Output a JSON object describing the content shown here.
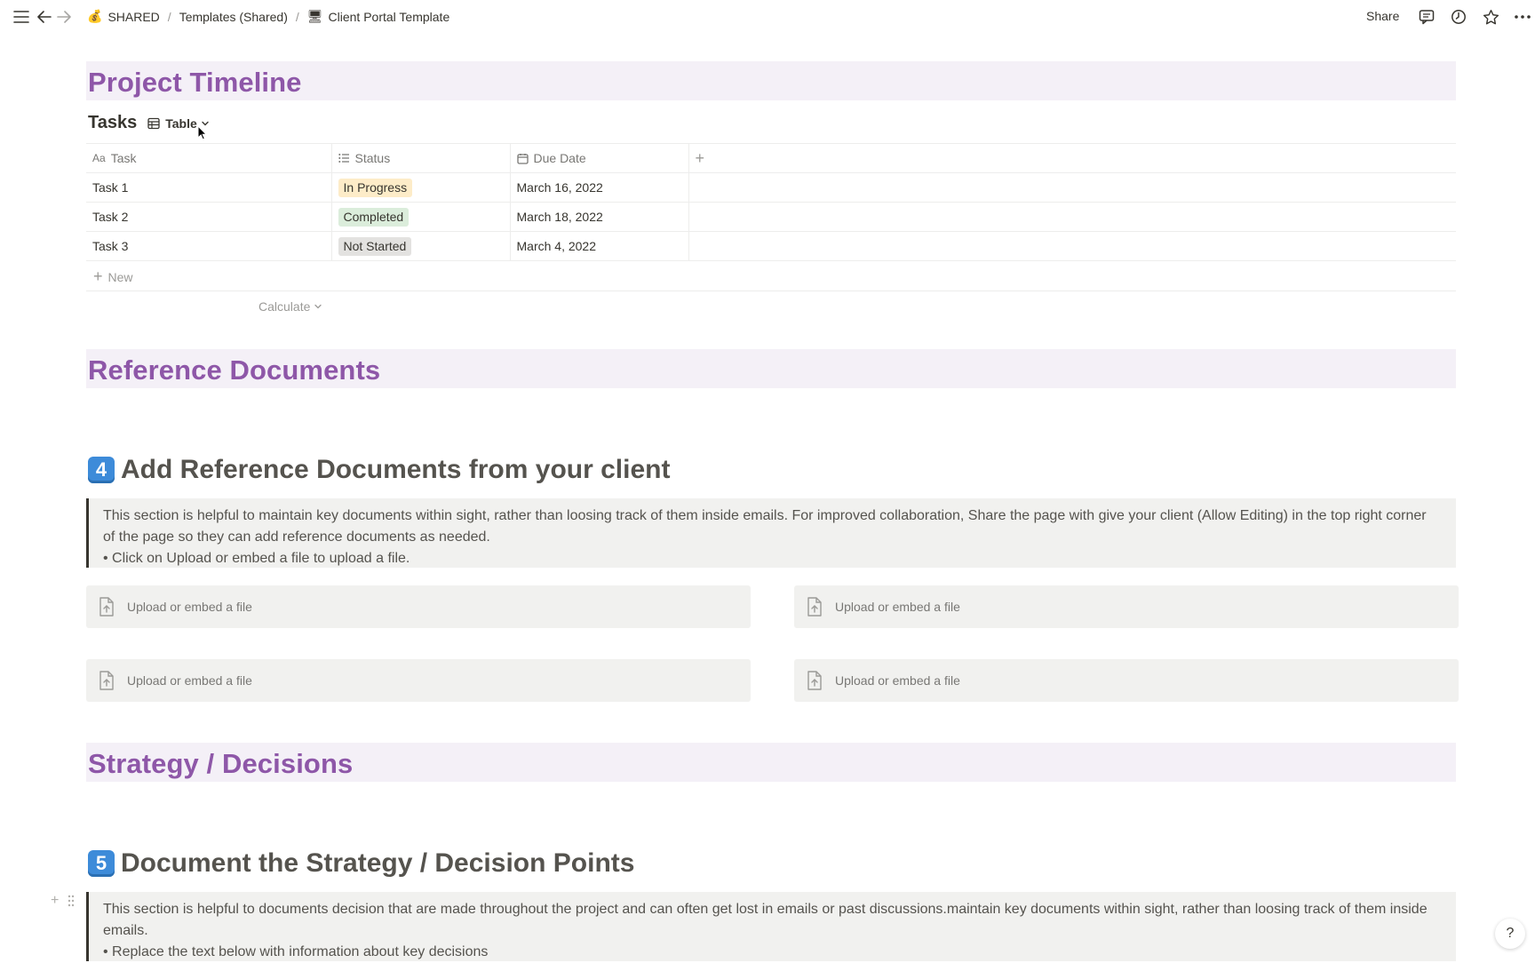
{
  "breadcrumbs": [
    {
      "icon": "💰",
      "label": "SHARED"
    },
    {
      "label": "Templates (Shared)"
    },
    {
      "icon": "🖥",
      "label": "Client Portal Template"
    }
  ],
  "topbar": {
    "share_label": "Share"
  },
  "sections": {
    "timeline": "Project Timeline",
    "reference": "Reference Documents",
    "strategy": "Strategy / Decisions"
  },
  "tasks_view": {
    "title": "Tasks",
    "view_label": "Table",
    "columns": [
      "Task",
      "Status",
      "Due Date"
    ],
    "rows": [
      {
        "task": "Task 1",
        "status": "In Progress",
        "due": "March 16, 2022"
      },
      {
        "task": "Task 2",
        "status": "Completed",
        "due": "March 18, 2022"
      },
      {
        "task": "Task 3",
        "status": "Not Started",
        "due": "March 4, 2022"
      }
    ],
    "status_colors": {
      "In Progress": "#fdecc8",
      "Completed": "#dbeddb",
      "Not Started": "#e3e2e0"
    },
    "new_label": "New",
    "calculate_label": "Calculate"
  },
  "step4": {
    "number": "4",
    "title": "Add Reference Documents from your client",
    "callout_text": "This section is helpful to maintain key documents within sight, rather than loosing track of them inside emails. For improved collaboration, Share the page with give your client (Allow Editing) in the top right corner of the page so they can add reference documents as needed.",
    "callout_bullet": "• Click on Upload or embed a file to upload a file."
  },
  "uploads": [
    "Upload or embed a file",
    "Upload or embed a file",
    "Upload or embed a file",
    "Upload or embed a file"
  ],
  "step5": {
    "number": "5",
    "title": "Document the Strategy / Decision Points",
    "callout_text": "This section is helpful to documents decision that are made throughout the project and can often get lost in emails or past discussions.maintain key documents within sight, rather than loosing track of them inside emails.",
    "callout_bullet": "• Replace the text below with information about key decisions"
  },
  "help_label": "?"
}
